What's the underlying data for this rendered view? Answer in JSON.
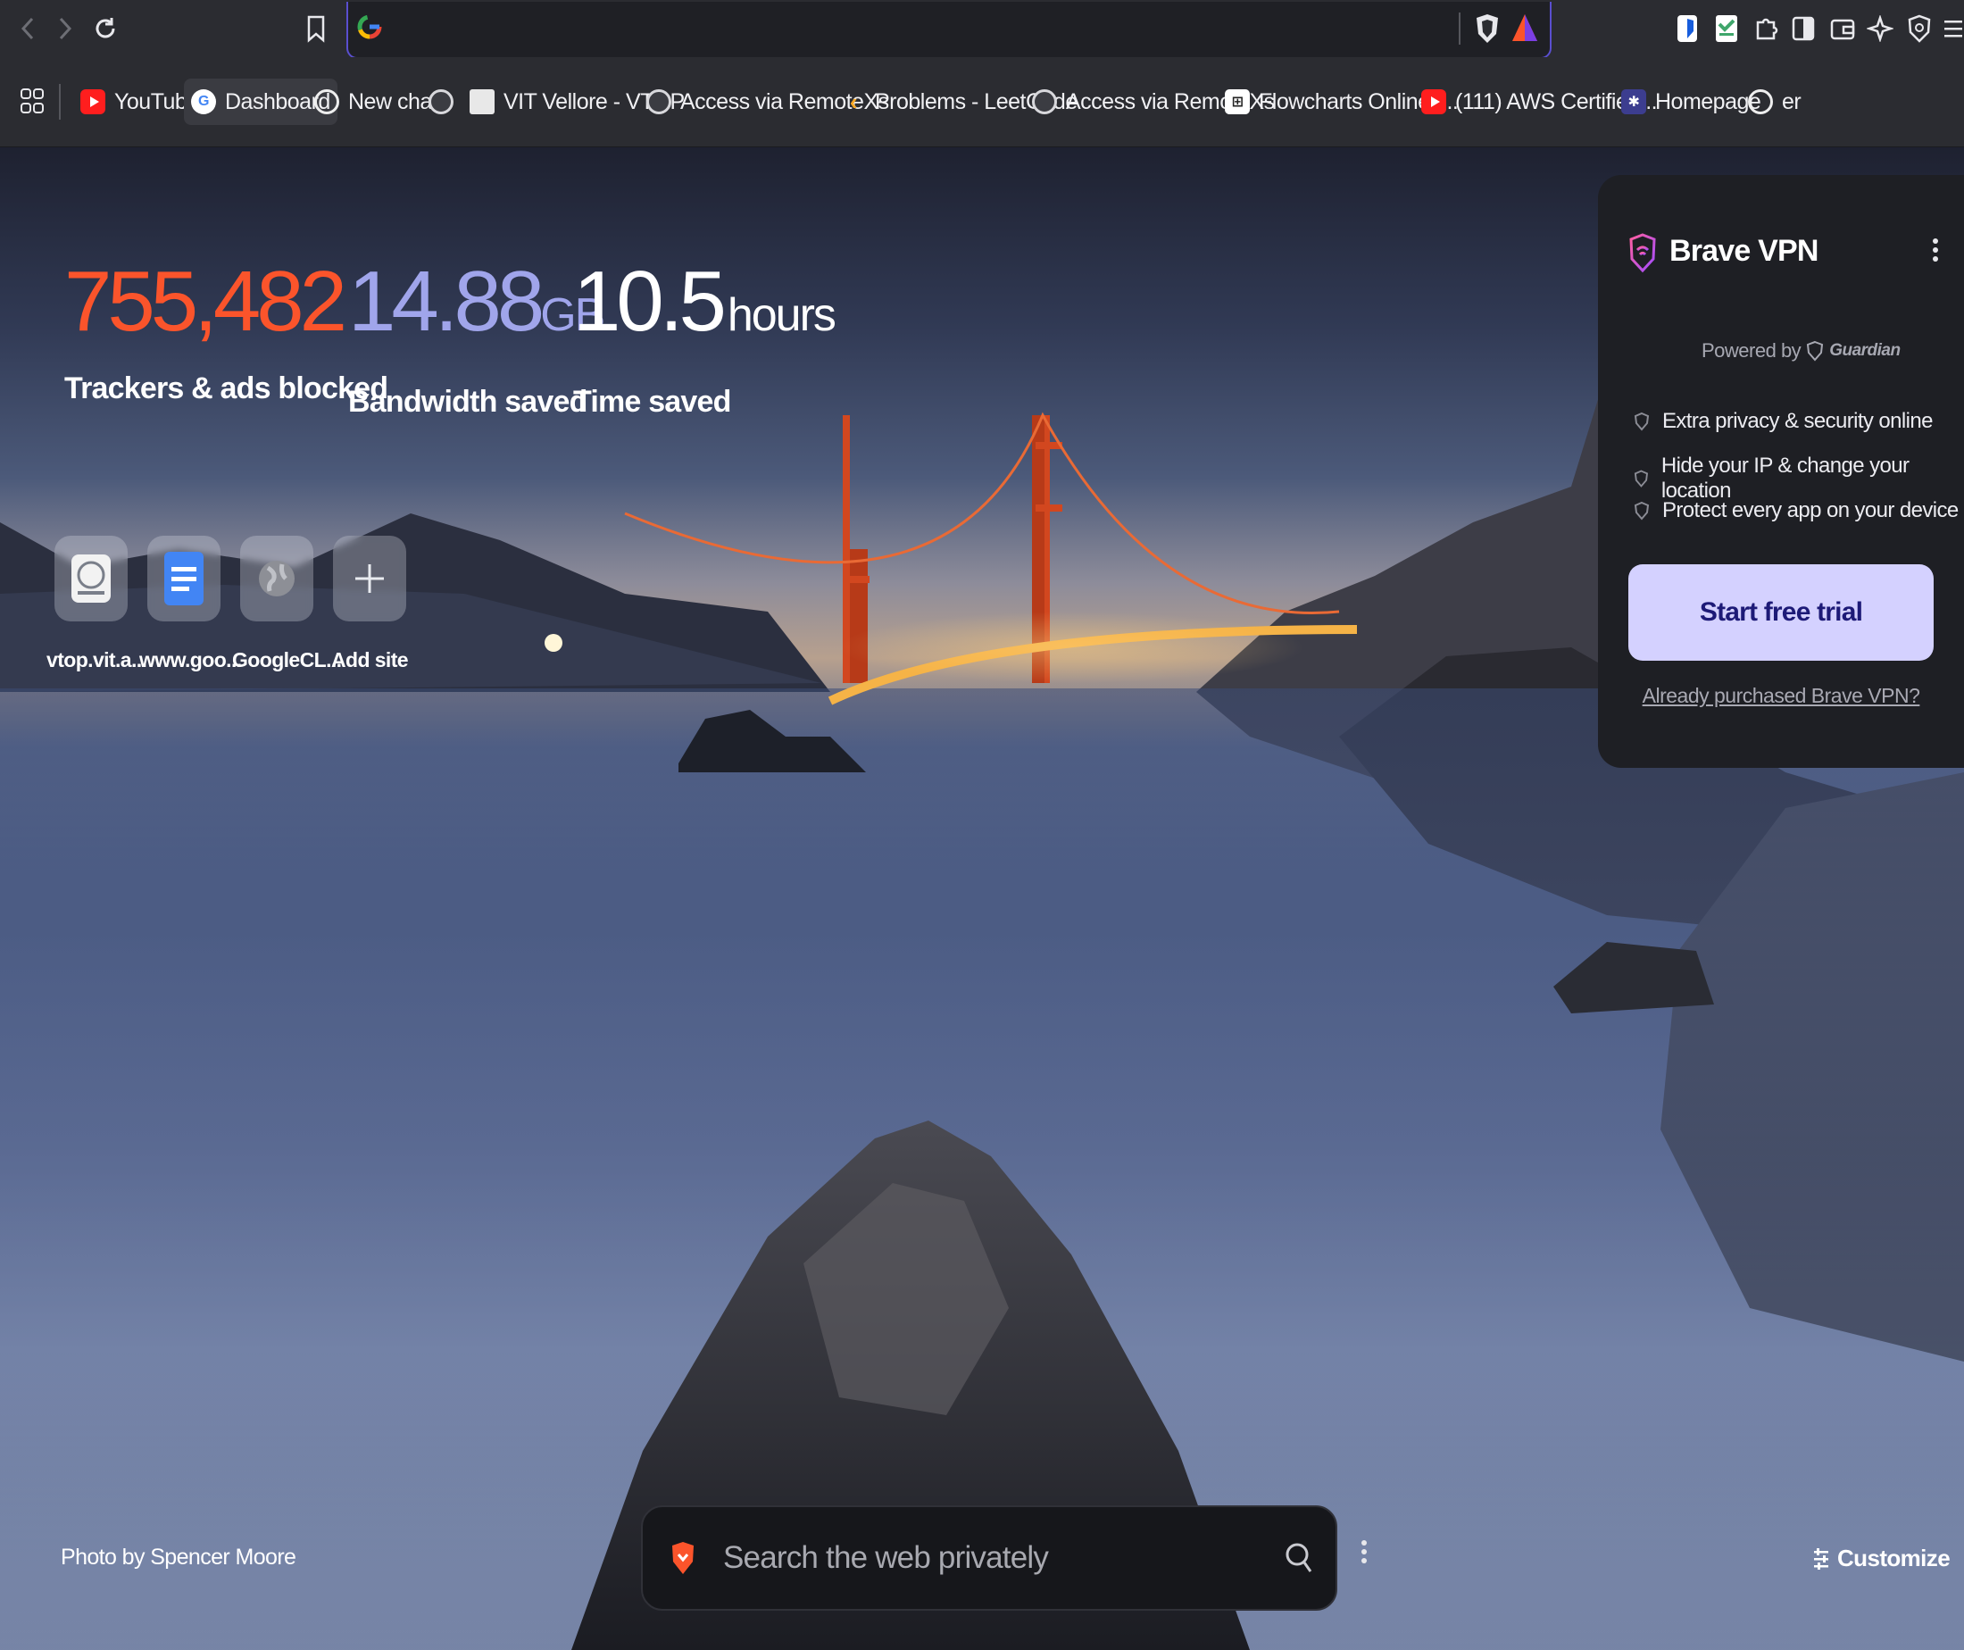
{
  "browser": {
    "accent": "#5a4fcf",
    "nav_icons": [
      "back-icon",
      "forward-icon",
      "reload-icon",
      "bookmark-icon"
    ],
    "address_favicon": "google-icon",
    "extension_icons": [
      "brave-shields-icon",
      "brave-rewards-icon",
      "bitwarden-icon",
      "extension-green-icon",
      "puzzle-icon",
      "sidebar-icon",
      "wallet-icon",
      "leo-icon",
      "vpn-shield-icon",
      "menu-icon"
    ]
  },
  "bookmarks": {
    "apps_icon": "apps-grid-icon",
    "items": [
      {
        "label": "YouTube",
        "icon": "youtube-icon"
      },
      {
        "label": "Dashboard",
        "icon": "google-icon"
      },
      {
        "label": "New chat",
        "icon": "openai-icon"
      },
      {
        "label": "",
        "icon": "globe-icon"
      },
      {
        "label": "VIT Vellore - VTOP",
        "icon": "vit-icon"
      },
      {
        "label": "Access via RemoteXs",
        "icon": "globe-icon"
      },
      {
        "label": "Problems - LeetCode",
        "icon": "leetcode-icon"
      },
      {
        "label": "Access via RemoteXs",
        "icon": "globe-icon"
      },
      {
        "label": "Flowcharts Online |...",
        "icon": "flowchart-icon"
      },
      {
        "label": "(111) AWS Certified...",
        "icon": "youtube-icon"
      },
      {
        "label": "Homepage",
        "icon": "homepage-icon"
      },
      {
        "label": "er",
        "icon": "openai-icon"
      }
    ]
  },
  "stats": {
    "trackers": {
      "value": "755,482",
      "label": "Trackers & ads blocked",
      "color": "#fb542b"
    },
    "bandwidth": {
      "value": "14.88",
      "unit": "GB",
      "label": "Bandwidth saved",
      "color": "#a0a5eb"
    },
    "time": {
      "value": "10.5",
      "unit": "hours",
      "label": "Time saved",
      "color": "#ffffff"
    }
  },
  "top_sites": [
    {
      "label": "vtop.vit.a...",
      "icon": "vit-logo-icon"
    },
    {
      "label": "www.goo...",
      "icon": "google-docs-icon"
    },
    {
      "label": "GoogleCL...",
      "icon": "globe-icon"
    },
    {
      "label": "Add site",
      "icon": "plus-icon"
    }
  ],
  "vpn": {
    "title": "Brave VPN",
    "powered_by": "Powered by",
    "partner": "Guardian",
    "features": [
      "Extra privacy & security online",
      "Hide your IP & change your location",
      "Protect every app on your device"
    ],
    "cta": "Start free trial",
    "already": "Already purchased Brave VPN?",
    "cta_color": "#d4d1ff"
  },
  "footer": {
    "credit": "Photo by Spencer Moore",
    "search_placeholder": "Search the web privately",
    "customize": "Customize"
  }
}
